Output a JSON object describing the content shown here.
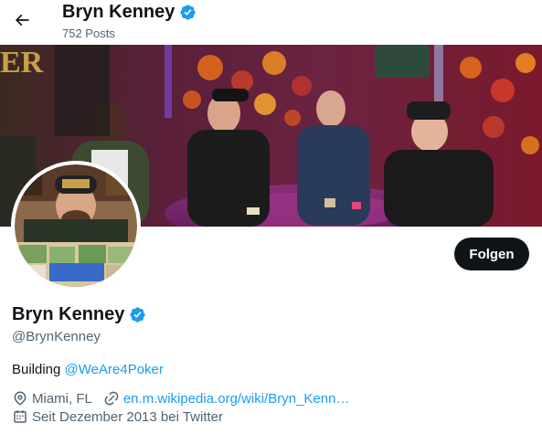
{
  "header": {
    "back_icon": "arrow-left-icon",
    "name": "Bryn Kenney",
    "posts": "752 Posts"
  },
  "banner": {
    "description_icon": "banner-image"
  },
  "profile": {
    "follow_label": "Folgen",
    "name": "Bryn Kenney",
    "handle": "@BrynKenney",
    "bio_text": "Building ",
    "bio_link": "@WeAre4Poker",
    "location": "Miami, FL",
    "website": "en.m.wikipedia.org/wiki/Bryn_Kenn…",
    "joined": "Seit Dezember 2013 bei Twitter"
  },
  "colors": {
    "accent": "#1d9bf0",
    "follow_bg": "#0f1419",
    "muted": "#536471"
  }
}
